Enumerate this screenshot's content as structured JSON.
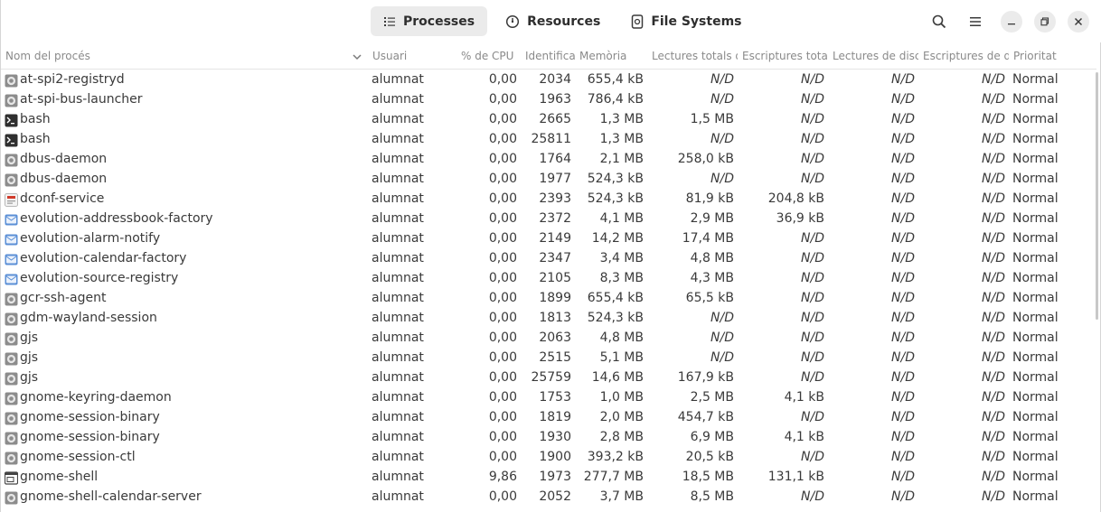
{
  "tabs": [
    {
      "label": "Processes",
      "active": true,
      "icon": "list-icon"
    },
    {
      "label": "Resources",
      "active": false,
      "icon": "gauge-icon"
    },
    {
      "label": "File Systems",
      "active": false,
      "icon": "disk-icon"
    }
  ],
  "header_icons": [
    "search-icon",
    "menu-icon",
    "minimize-icon",
    "maximize-icon",
    "close-icon"
  ],
  "columns": {
    "name": "Nom del procés",
    "user": "Usuari",
    "cpu": "% de CPU",
    "id": "Identifica",
    "mem": "Memòria",
    "reads": "Lectures totals d",
    "writes": "Escriptures total",
    "disk_reads": "Lectures de disc",
    "disk_writes": "Escriptures de di",
    "priority": "Prioritat"
  },
  "rows": [
    {
      "icon": "gear",
      "name": "at-spi2-registryd",
      "user": "alumnat",
      "cpu": "0,00",
      "id": "2034",
      "mem": "655,4 kB",
      "reads": "N/D",
      "writes": "N/D",
      "disk_reads": "N/D",
      "disk_writes": "N/D",
      "priority": "Normal"
    },
    {
      "icon": "gear",
      "name": "at-spi-bus-launcher",
      "user": "alumnat",
      "cpu": "0,00",
      "id": "1963",
      "mem": "786,4 kB",
      "reads": "N/D",
      "writes": "N/D",
      "disk_reads": "N/D",
      "disk_writes": "N/D",
      "priority": "Normal"
    },
    {
      "icon": "terminal",
      "name": "bash",
      "user": "alumnat",
      "cpu": "0,00",
      "id": "2665",
      "mem": "1,3 MB",
      "reads": "1,5 MB",
      "writes": "N/D",
      "disk_reads": "N/D",
      "disk_writes": "N/D",
      "priority": "Normal"
    },
    {
      "icon": "terminal",
      "name": "bash",
      "user": "alumnat",
      "cpu": "0,00",
      "id": "25811",
      "mem": "1,3 MB",
      "reads": "N/D",
      "writes": "N/D",
      "disk_reads": "N/D",
      "disk_writes": "N/D",
      "priority": "Normal"
    },
    {
      "icon": "gear",
      "name": "dbus-daemon",
      "user": "alumnat",
      "cpu": "0,00",
      "id": "1764",
      "mem": "2,1 MB",
      "reads": "258,0 kB",
      "writes": "N/D",
      "disk_reads": "N/D",
      "disk_writes": "N/D",
      "priority": "Normal"
    },
    {
      "icon": "gear",
      "name": "dbus-daemon",
      "user": "alumnat",
      "cpu": "0,00",
      "id": "1977",
      "mem": "524,3 kB",
      "reads": "N/D",
      "writes": "N/D",
      "disk_reads": "N/D",
      "disk_writes": "N/D",
      "priority": "Normal"
    },
    {
      "icon": "dconf",
      "name": "dconf-service",
      "user": "alumnat",
      "cpu": "0,00",
      "id": "2393",
      "mem": "524,3 kB",
      "reads": "81,9 kB",
      "writes": "204,8 kB",
      "disk_reads": "N/D",
      "disk_writes": "N/D",
      "priority": "Normal"
    },
    {
      "icon": "evolution",
      "name": "evolution-addressbook-factory",
      "user": "alumnat",
      "cpu": "0,00",
      "id": "2372",
      "mem": "4,1 MB",
      "reads": "2,9 MB",
      "writes": "36,9 kB",
      "disk_reads": "N/D",
      "disk_writes": "N/D",
      "priority": "Normal"
    },
    {
      "icon": "evolution",
      "name": "evolution-alarm-notify",
      "user": "alumnat",
      "cpu": "0,00",
      "id": "2149",
      "mem": "14,2 MB",
      "reads": "17,4 MB",
      "writes": "N/D",
      "disk_reads": "N/D",
      "disk_writes": "N/D",
      "priority": "Normal"
    },
    {
      "icon": "evolution",
      "name": "evolution-calendar-factory",
      "user": "alumnat",
      "cpu": "0,00",
      "id": "2347",
      "mem": "3,4 MB",
      "reads": "4,8 MB",
      "writes": "N/D",
      "disk_reads": "N/D",
      "disk_writes": "N/D",
      "priority": "Normal"
    },
    {
      "icon": "evolution",
      "name": "evolution-source-registry",
      "user": "alumnat",
      "cpu": "0,00",
      "id": "2105",
      "mem": "8,3 MB",
      "reads": "4,3 MB",
      "writes": "N/D",
      "disk_reads": "N/D",
      "disk_writes": "N/D",
      "priority": "Normal"
    },
    {
      "icon": "gear",
      "name": "gcr-ssh-agent",
      "user": "alumnat",
      "cpu": "0,00",
      "id": "1899",
      "mem": "655,4 kB",
      "reads": "65,5 kB",
      "writes": "N/D",
      "disk_reads": "N/D",
      "disk_writes": "N/D",
      "priority": "Normal"
    },
    {
      "icon": "gear",
      "name": "gdm-wayland-session",
      "user": "alumnat",
      "cpu": "0,00",
      "id": "1813",
      "mem": "524,3 kB",
      "reads": "N/D",
      "writes": "N/D",
      "disk_reads": "N/D",
      "disk_writes": "N/D",
      "priority": "Normal"
    },
    {
      "icon": "gear",
      "name": "gjs",
      "user": "alumnat",
      "cpu": "0,00",
      "id": "2063",
      "mem": "4,8 MB",
      "reads": "N/D",
      "writes": "N/D",
      "disk_reads": "N/D",
      "disk_writes": "N/D",
      "priority": "Normal"
    },
    {
      "icon": "gear",
      "name": "gjs",
      "user": "alumnat",
      "cpu": "0,00",
      "id": "2515",
      "mem": "5,1 MB",
      "reads": "N/D",
      "writes": "N/D",
      "disk_reads": "N/D",
      "disk_writes": "N/D",
      "priority": "Normal"
    },
    {
      "icon": "gear",
      "name": "gjs",
      "user": "alumnat",
      "cpu": "0,00",
      "id": "25759",
      "mem": "14,6 MB",
      "reads": "167,9 kB",
      "writes": "N/D",
      "disk_reads": "N/D",
      "disk_writes": "N/D",
      "priority": "Normal"
    },
    {
      "icon": "gear",
      "name": "gnome-keyring-daemon",
      "user": "alumnat",
      "cpu": "0,00",
      "id": "1753",
      "mem": "1,0 MB",
      "reads": "2,5 MB",
      "writes": "4,1 kB",
      "disk_reads": "N/D",
      "disk_writes": "N/D",
      "priority": "Normal"
    },
    {
      "icon": "gear",
      "name": "gnome-session-binary",
      "user": "alumnat",
      "cpu": "0,00",
      "id": "1819",
      "mem": "2,0 MB",
      "reads": "454,7 kB",
      "writes": "N/D",
      "disk_reads": "N/D",
      "disk_writes": "N/D",
      "priority": "Normal"
    },
    {
      "icon": "gear",
      "name": "gnome-session-binary",
      "user": "alumnat",
      "cpu": "0,00",
      "id": "1930",
      "mem": "2,8 MB",
      "reads": "6,9 MB",
      "writes": "4,1 kB",
      "disk_reads": "N/D",
      "disk_writes": "N/D",
      "priority": "Normal"
    },
    {
      "icon": "gear",
      "name": "gnome-session-ctl",
      "user": "alumnat",
      "cpu": "0,00",
      "id": "1900",
      "mem": "393,2 kB",
      "reads": "20,5 kB",
      "writes": "N/D",
      "disk_reads": "N/D",
      "disk_writes": "N/D",
      "priority": "Normal"
    },
    {
      "icon": "window",
      "name": "gnome-shell",
      "user": "alumnat",
      "cpu": "9,86",
      "id": "1973",
      "mem": "277,7 MB",
      "reads": "18,5 MB",
      "writes": "131,1 kB",
      "disk_reads": "N/D",
      "disk_writes": "N/D",
      "priority": "Normal"
    },
    {
      "icon": "gear",
      "name": "gnome-shell-calendar-server",
      "user": "alumnat",
      "cpu": "0,00",
      "id": "2052",
      "mem": "3,7 MB",
      "reads": "8,5 MB",
      "writes": "N/D",
      "disk_reads": "N/D",
      "disk_writes": "N/D",
      "priority": "Normal"
    }
  ]
}
